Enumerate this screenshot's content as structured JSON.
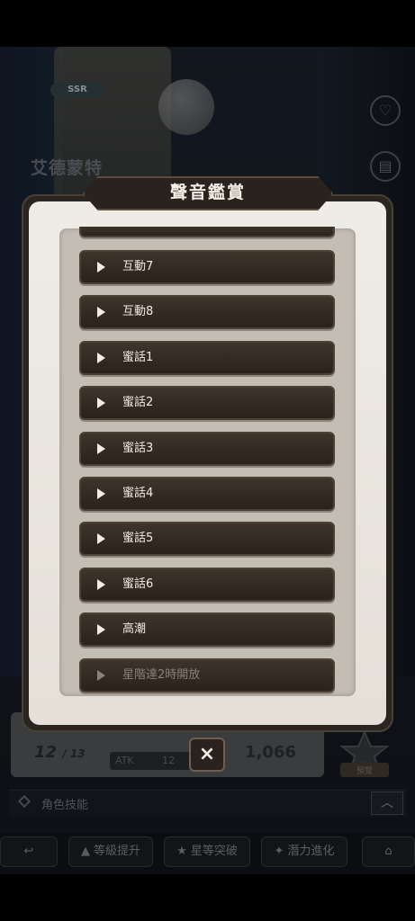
{
  "background": {
    "rank": "SSR",
    "character_name": "艾德蒙特",
    "level": "12",
    "level_max": "/ 13",
    "atk_label": "ATK",
    "atk_value_partial": "12",
    "atk_value": "1,066",
    "star_badge_label": "預覽",
    "skills_label": "角色技能",
    "skills_toggle": "︿"
  },
  "bottom_nav": {
    "back_label": "↩",
    "level_up_label": "等級提升",
    "star_break_label": "星等突破",
    "potential_label": "潛力進化",
    "home_label": "⌂"
  },
  "modal": {
    "title": "聲音鑑賞",
    "items": [
      {
        "label": "互動7",
        "locked": false
      },
      {
        "label": "互動8",
        "locked": false
      },
      {
        "label": "蜜話1",
        "locked": false
      },
      {
        "label": "蜜話2",
        "locked": false
      },
      {
        "label": "蜜話3",
        "locked": false
      },
      {
        "label": "蜜話4",
        "locked": false
      },
      {
        "label": "蜜話5",
        "locked": false
      },
      {
        "label": "蜜話6",
        "locked": false
      },
      {
        "label": "高潮",
        "locked": false
      },
      {
        "label": "星階達2時開放",
        "locked": true
      }
    ],
    "close_label": "×"
  },
  "colors": {
    "modal_bg": "#efece6",
    "row_bg": "#2a221b",
    "row_text": "#f0ebe4",
    "locked_text": "#8a8279"
  }
}
